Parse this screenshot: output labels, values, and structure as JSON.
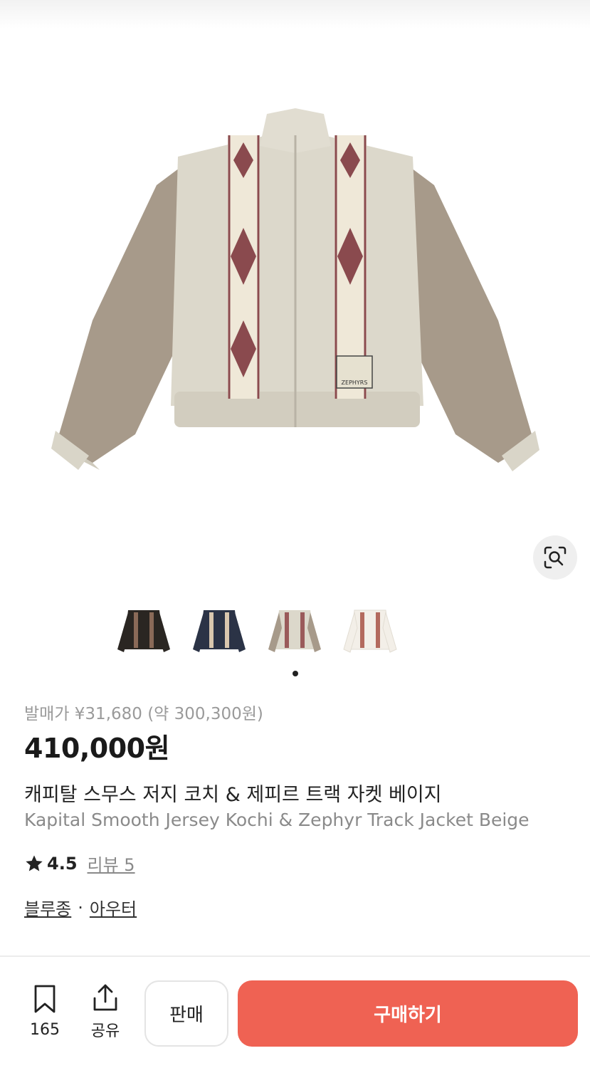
{
  "product": {
    "release_price": "발매가 ¥31,680 (약 300,300원)",
    "price": "410,000원",
    "name_ko": "캐피탈 스무스 저지 코치 & 제피르 트랙 자켓 베이지",
    "name_en": "Kapital Smooth Jersey Kochi & Zephyr Track Jacket Beige",
    "patch_text": "ZEPHYRS"
  },
  "rating": {
    "score": "4.5",
    "review_label": "리뷰 5"
  },
  "categories": {
    "primary": "블루종",
    "separator": "·",
    "secondary": "아우터"
  },
  "thumbnails": [
    {
      "name": "black",
      "color": "#2a2622"
    },
    {
      "name": "navy",
      "color": "#2b3346"
    },
    {
      "name": "beige",
      "color": "#d8d3c6"
    },
    {
      "name": "white",
      "color": "#f3efe8"
    }
  ],
  "bottom_bar": {
    "bookmark_count": "165",
    "share_label": "공유",
    "sell_label": "판매",
    "buy_label": "구매하기"
  },
  "colors": {
    "accent": "#ef6253",
    "body": "#dcd8cb",
    "sleeve": "#a79a8a",
    "pattern": "#8a4a4e"
  },
  "icons": {
    "lens": "lens-search-icon",
    "bookmark": "bookmark-icon",
    "share": "share-icon",
    "star": "star-icon"
  }
}
